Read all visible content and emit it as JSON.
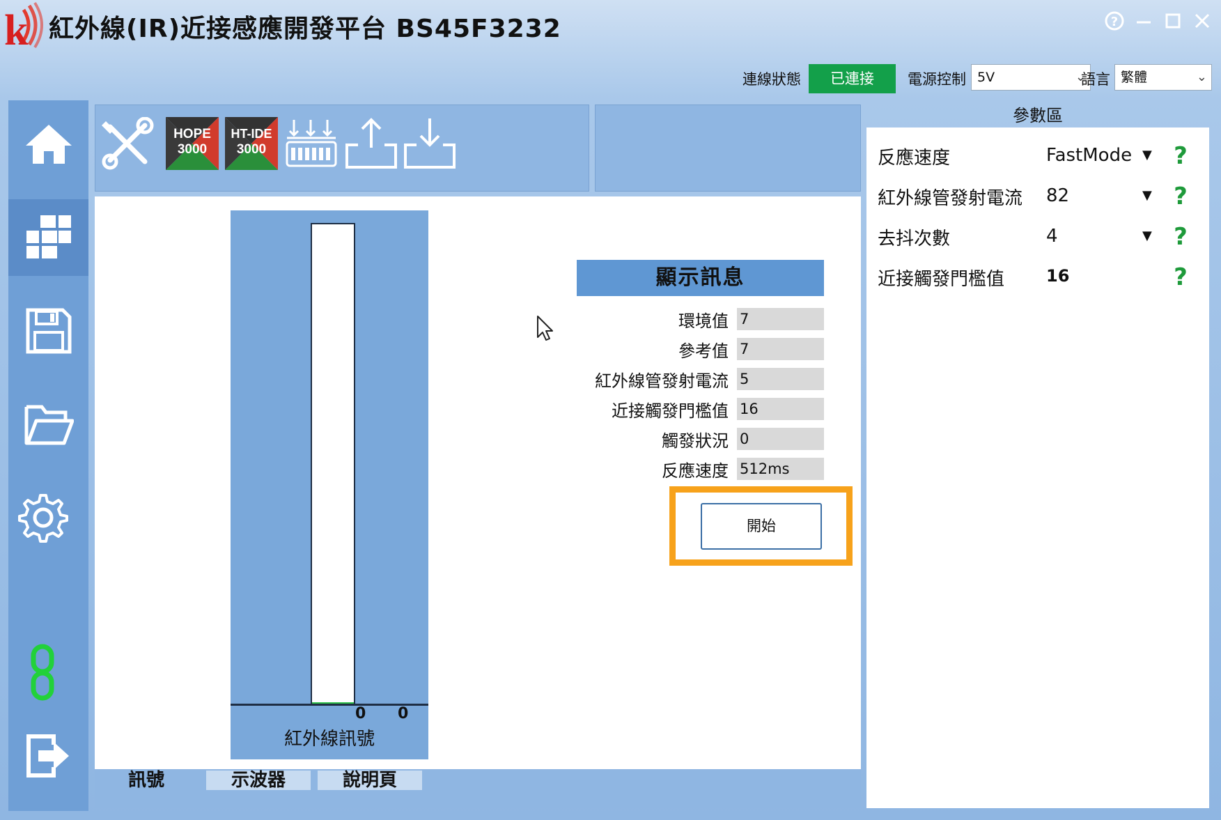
{
  "window": {
    "title": "紅外線(IR)近接感應開發平台 BS45F3232",
    "accent_color": "#8fb6e2",
    "controls": [
      "help-icon",
      "minimize-icon",
      "maximize-icon",
      "close-icon"
    ]
  },
  "status_bar": {
    "connection_label": "連線狀態",
    "connection_value": "已連接",
    "connection_color": "#13a04a",
    "power_label": "電源控制",
    "power_value": "5V",
    "language_label": "語言",
    "language_value": "繁體"
  },
  "sidebar": {
    "items": [
      {
        "name": "home",
        "icon": "home-icon"
      },
      {
        "name": "modules",
        "icon": "grid-icon",
        "active": true
      },
      {
        "name": "save",
        "icon": "floppy-icon"
      },
      {
        "name": "open",
        "icon": "folder-icon"
      },
      {
        "name": "settings",
        "icon": "gear-icon"
      },
      {
        "name": "link",
        "icon": "chain-link-icon",
        "color": "#22d13a"
      },
      {
        "name": "exit",
        "icon": "exit-icon"
      }
    ]
  },
  "toolbar": {
    "tools": [
      {
        "name": "tools",
        "icon": "wrench-screwdriver-icon"
      },
      {
        "name": "hope3000",
        "line1": "HOPE",
        "line2": "3000"
      },
      {
        "name": "htide3000",
        "line1": "HT-IDE",
        "line2": "3000"
      },
      {
        "name": "program",
        "icon": "chip-program-icon"
      },
      {
        "name": "upload",
        "icon": "upload-icon"
      },
      {
        "name": "download",
        "icon": "download-icon"
      }
    ]
  },
  "gauge": {
    "caption": "紅外線訊號",
    "value_a": "0",
    "value_b": "0",
    "fill_color": "#2fbf4a"
  },
  "info": {
    "header": "顯示訊息",
    "rows": [
      {
        "label": "環境值",
        "value": "7"
      },
      {
        "label": "參考值",
        "value": "7"
      },
      {
        "label": "紅外線管發射電流",
        "value": "5"
      },
      {
        "label": "近接觸發門檻值",
        "value": "16"
      },
      {
        "label": "觸發狀況",
        "value": "0"
      },
      {
        "label": "反應速度",
        "value": "512ms"
      }
    ],
    "start_label": "開始",
    "highlight_color": "#f7a21b"
  },
  "tabs": [
    {
      "label": "訊號",
      "active": true
    },
    {
      "label": "示波器",
      "active": false
    },
    {
      "label": "說明頁",
      "active": false
    }
  ],
  "params": {
    "header": "參數區",
    "rows": [
      {
        "label": "反應速度",
        "value": "FastMode",
        "dropdown": true
      },
      {
        "label": "紅外線管發射電流",
        "value": "82",
        "dropdown": true
      },
      {
        "label": "去抖次數",
        "value": "4",
        "dropdown": true
      },
      {
        "label": "近接觸發門檻值",
        "value": "16",
        "dropdown": false
      }
    ],
    "help_symbol": "?"
  }
}
